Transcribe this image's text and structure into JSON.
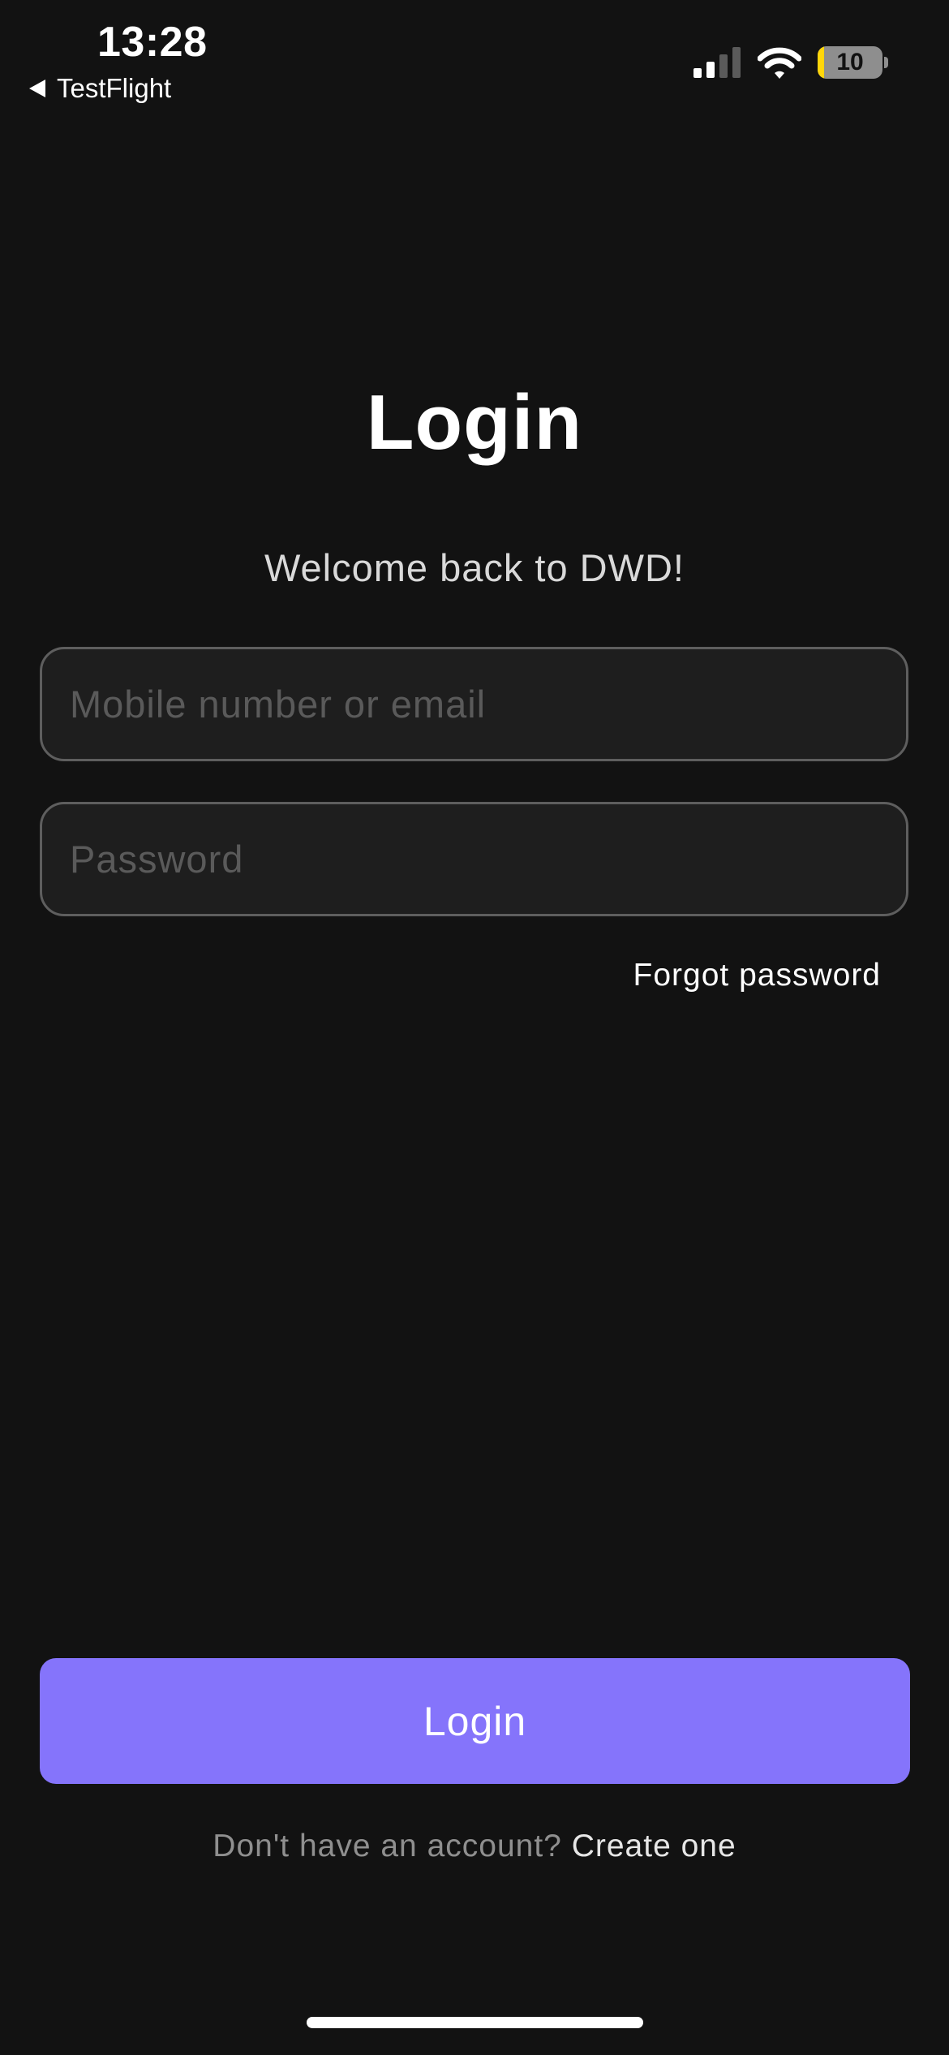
{
  "status_bar": {
    "time": "13:28",
    "back_label": "TestFlight",
    "battery_level": "10",
    "battery_fraction": 0.1,
    "battery_color": "#ffd60a",
    "icons": [
      "signal-icon",
      "wifi-icon",
      "battery-icon"
    ]
  },
  "login": {
    "title": "Login",
    "subtitle": "Welcome back to DWD!",
    "email_placeholder": "Mobile number or email",
    "email_value": "",
    "password_placeholder": "Password",
    "password_value": "",
    "forgot_password": "Forgot password",
    "login_button": "Login",
    "signup_prompt": "Don't have an account?",
    "signup_link": "Create one"
  },
  "colors": {
    "background": "#121212",
    "accent": "#8574fb",
    "field_background": "#1e1e1e",
    "field_border": "#5e5e5e"
  }
}
